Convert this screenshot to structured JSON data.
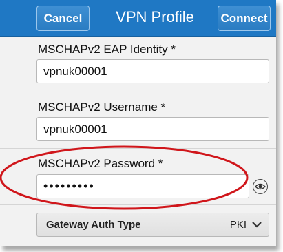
{
  "header": {
    "cancel_label": "Cancel",
    "title": "VPN Profile",
    "connect_label": "Connect"
  },
  "fields": {
    "eap_identity": {
      "label": "MSCHAPv2 EAP Identity *",
      "value": "vpnuk00001"
    },
    "username": {
      "label": "MSCHAPv2 Username *",
      "value": "vpnuk00001"
    },
    "password": {
      "label": "MSCHAPv2 Password *",
      "value": "•••••••••"
    }
  },
  "gateway": {
    "label": "Gateway Auth Type",
    "value": "PKI"
  },
  "icons": {
    "show_password": "eye-icon",
    "dropdown": "chevron-down-icon"
  },
  "colors": {
    "header": "#1f78c4",
    "highlight_ellipse": "#d0161b"
  }
}
